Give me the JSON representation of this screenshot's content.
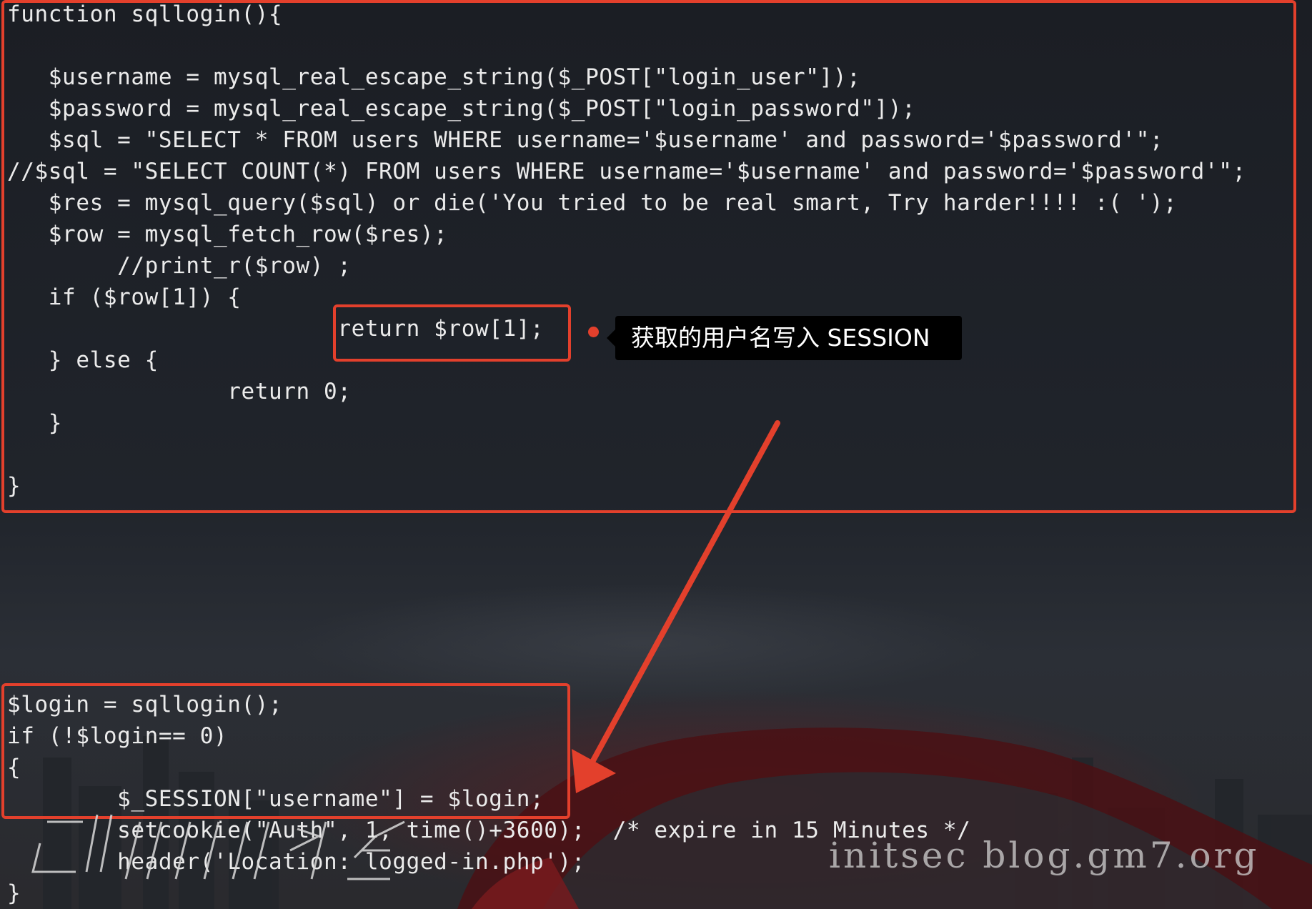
{
  "code_top": [
    "function sqllogin(){",
    "",
    "   $username = mysql_real_escape_string($_POST[\"login_user\"]);",
    "   $password = mysql_real_escape_string($_POST[\"login_password\"]);",
    "   $sql = \"SELECT * FROM users WHERE username='$username' and password='$password'\";",
    "//$sql = \"SELECT COUNT(*) FROM users WHERE username='$username' and password='$password'\";",
    "   $res = mysql_query($sql) or die('You tried to be real smart, Try harder!!!! :( ');",
    "   $row = mysql_fetch_row($res);",
    "        //print_r($row) ;",
    "   if ($row[1]) {",
    "                        return $row[1];",
    "   } else {",
    "                return 0;",
    "   }",
    "",
    "}"
  ],
  "code_bottom": [
    "$login = sqllogin();",
    "if (!$login== 0)",
    "{",
    "        $_SESSION[\"username\"] = $login;",
    "        setcookie(\"Auth\", 1, time()+3600);  /* expire in 15 Minutes */",
    "        header('Location: logged-in.php');",
    "}"
  ],
  "annotation": {
    "text": "获取的用户名写入 SESSION",
    "color": "#e3402c"
  },
  "watermark": "initsec blog.gm7.org",
  "colors": {
    "background": "#1d2026",
    "code_text": "#ebebeb",
    "highlight_border": "#e3402c",
    "tooltip_bg": "#000000"
  }
}
